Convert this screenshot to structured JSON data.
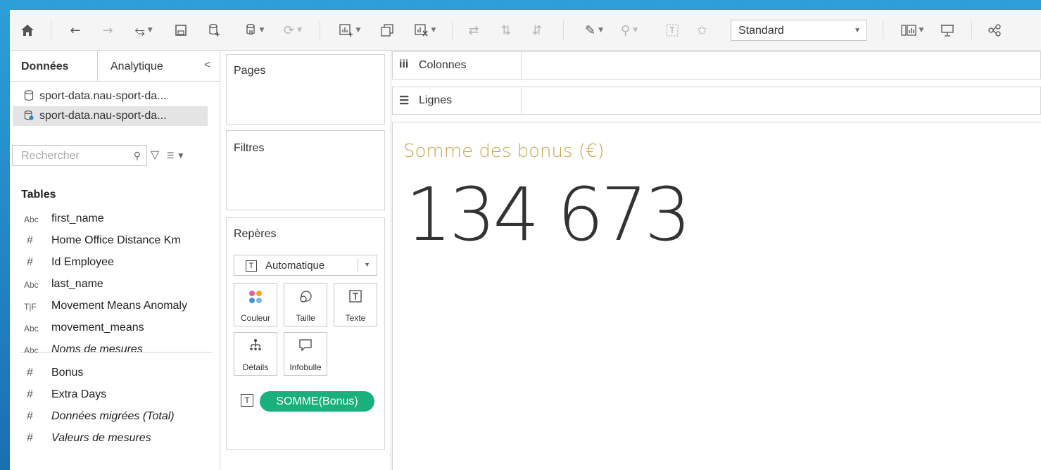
{
  "toolbar": {
    "view_mode": "Standard"
  },
  "left_pane": {
    "tab_data": "Données",
    "tab_analytics": "Analytique",
    "datasources": [
      "sport-data.nau-sport-da...",
      "sport-data.nau-sport-da..."
    ],
    "search_placeholder": "Rechercher",
    "tables_heading": "Tables",
    "dimensions": [
      {
        "type": "Abc",
        "name": "first_name"
      },
      {
        "type": "#",
        "name": "Home Office Distance Km"
      },
      {
        "type": "#",
        "name": "Id Employee"
      },
      {
        "type": "Abc",
        "name": "last_name"
      },
      {
        "type": "T|F",
        "name": "Movement Means Anomaly"
      },
      {
        "type": "Abc",
        "name": "movement_means"
      },
      {
        "type": "Abc",
        "name": "Noms de mesures"
      }
    ],
    "measures": [
      {
        "type": "#",
        "name": "Bonus"
      },
      {
        "type": "#",
        "name": "Extra Days"
      },
      {
        "type": "#",
        "name": "Données migrées (Total)"
      },
      {
        "type": "#",
        "name": "Valeurs de mesures"
      }
    ]
  },
  "cards": {
    "pages": "Pages",
    "filters": "Filtres",
    "marks": "Repères",
    "marks_type": "Automatique",
    "mark_buttons": {
      "color": "Couleur",
      "size": "Taille",
      "text": "Texte",
      "detail": "Détails",
      "tooltip": "Infobulle"
    },
    "text_pill": "SOMME(Bonus)"
  },
  "shelves": {
    "columns": "Colonnes",
    "rows": "Lignes"
  },
  "viz": {
    "title": "Somme des bonus (€)",
    "value": "134 673"
  }
}
